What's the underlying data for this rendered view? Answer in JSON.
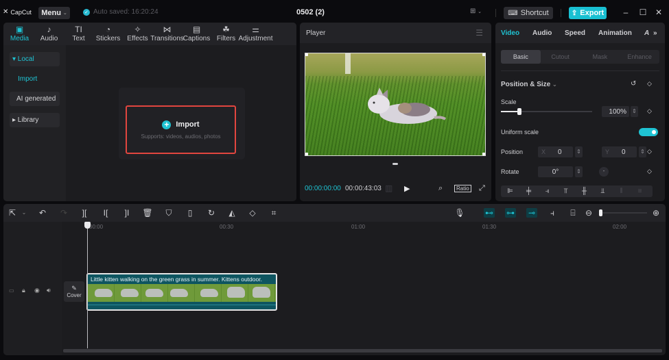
{
  "titlebar": {
    "app_name": "CapCut",
    "menu_label": "Menu",
    "autosave_text": "Auto saved: 16:20:24",
    "project_title": "0502 (2)",
    "shortcut_label": "Shortcut",
    "export_label": "Export",
    "accent_color": "#19c0d2"
  },
  "tool_tabs": [
    {
      "label": "Media",
      "icon": "media-icon",
      "glyph": "▣",
      "active": true
    },
    {
      "label": "Audio",
      "icon": "audio-icon",
      "glyph": "♪"
    },
    {
      "label": "Text",
      "icon": "text-icon",
      "glyph": "TI"
    },
    {
      "label": "Stickers",
      "icon": "stickers-icon",
      "glyph": "◔"
    },
    {
      "label": "Effects",
      "icon": "effects-icon",
      "glyph": "✧"
    },
    {
      "label": "Transitions",
      "icon": "transitions-icon",
      "glyph": "⋈"
    },
    {
      "label": "Captions",
      "icon": "captions-icon",
      "glyph": "▤"
    },
    {
      "label": "Filters",
      "icon": "filters-icon",
      "glyph": "☘"
    },
    {
      "label": "Adjustment",
      "icon": "adjustment-icon",
      "glyph": "⚌"
    }
  ],
  "media_sidebar": {
    "local": "▾ Local",
    "import": "Import",
    "ai_generated": "AI generated",
    "library": "▸ Library"
  },
  "import_box": {
    "title": "Import",
    "subtitle": "Supports: videos, audios, photos"
  },
  "player": {
    "title": "Player",
    "current_time": "00:00:00:00",
    "duration": "00:00:43:03",
    "ratio_label": "Ratio"
  },
  "properties": {
    "tabs": [
      "Video",
      "Audio",
      "Speed",
      "Animation",
      "A"
    ],
    "active_tab": "Video",
    "subtabs": [
      "Basic",
      "Cutout",
      "Mask",
      "Enhance"
    ],
    "section_title": "Position & Size",
    "scale_label": "Scale",
    "scale_value": "100%",
    "scale_slider_fraction": 0.2,
    "uniform_scale_label": "Uniform scale",
    "uniform_scale_on": true,
    "position_label": "Position",
    "pos_x_label": "X",
    "pos_x": "0",
    "pos_y_label": "Y",
    "pos_y": "0",
    "rotate_label": "Rotate",
    "rotate_value": "0°"
  },
  "timeline": {
    "ruler": [
      "00:00",
      "00:30",
      "01:00",
      "01:30",
      "02:00"
    ],
    "cover_label": "Cover",
    "clip_title": "Little kitten walking on the green grass in summer. Kittens outdoor."
  }
}
